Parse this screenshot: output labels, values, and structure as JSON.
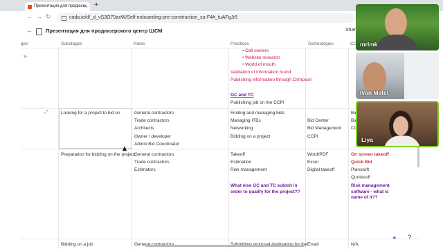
{
  "browser": {
    "tab_title": "Презентация для продюсе...",
    "url": "coda.io/d/_d_vS3O70axW/Self-onboarding-pre-construction_su-F4#_tuAFgJr5"
  },
  "doc": {
    "title": "Презентация для продюсерского центр ШСМ",
    "share_label": "Share"
  },
  "columns": {
    "stages": "ges",
    "substages": "Substages",
    "roles": "Roles",
    "practices": "Practices",
    "technologies": "Technologies",
    "cc": "CC"
  },
  "top_block": {
    "bullets": [
      "Call owners",
      "Website research",
      "World of mouth"
    ],
    "validation": "Validation of information found",
    "publishing": "Publishing information through Crimpson",
    "gc_tc": "GC and TC",
    "publishing_ccpi": "Publishing job on the CCPI"
  },
  "rows": [
    {
      "substage": "Looking for a project to bid on",
      "roles": [
        "General contractors",
        "Trade contractors",
        "Architects",
        "Owner / developer",
        "Admin Bid Coordinator"
      ],
      "practices": [
        "Finding and managing bids",
        "Managing ITBs",
        "Networking",
        "Bidding on a project"
      ],
      "technologies": [
        "",
        "Bid Center",
        "Bid Management",
        "CCPI"
      ],
      "cc": [
        "Bid",
        "Bid",
        "CC"
      ]
    },
    {
      "substage": "Preparation for bidding on the project",
      "roles": [
        "General contractors",
        "Trade contractors",
        "Estimators"
      ],
      "practices": [
        "Takeoff",
        "Estimation",
        "Risk management"
      ],
      "practices_note": "What else GC and TC submit in order to qualify for the project??",
      "technologies": [
        "Word/PDF",
        "Excel",
        "Digital takeoff"
      ],
      "cc": [
        "On screen takeoff",
        "Quick Bid",
        "Planswift",
        "Quotesoft"
      ],
      "cc_note": "Risk management software - what is name of it??"
    },
    {
      "substage": "Bidding on a job",
      "roles": [
        "General contractors"
      ],
      "practices": [
        "Submitting proposal (estimation for the"
      ],
      "technologies": [
        "Email"
      ],
      "cc": [
        "N/A"
      ]
    }
  ],
  "participants": [
    {
      "name": "mrlmk"
    },
    {
      "name": "Ivan Metel"
    },
    {
      "name": "Liya"
    }
  ],
  "icons": {
    "help": "?",
    "expand": "»"
  }
}
